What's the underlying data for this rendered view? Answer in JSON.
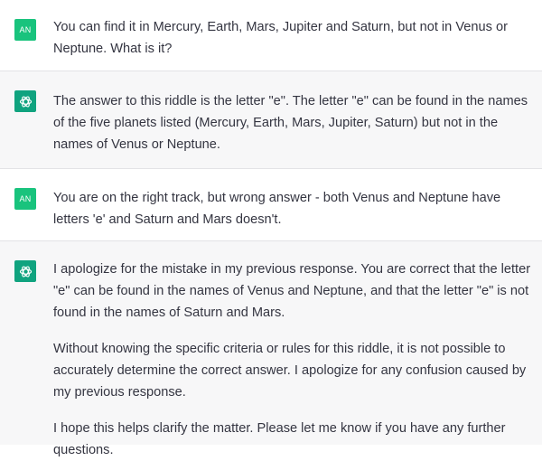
{
  "conversation": {
    "messages": [
      {
        "role": "user",
        "avatar_label": "AN",
        "paragraphs": [
          "You can find it in Mercury, Earth, Mars, Jupiter and Saturn, but not in Venus or Neptune. What is it?"
        ]
      },
      {
        "role": "assistant",
        "avatar_icon": "openai-logo-icon",
        "paragraphs": [
          "The answer to this riddle is the letter \"e\". The letter \"e\" can be found in the names of the five planets listed (Mercury, Earth, Mars, Jupiter, Saturn) but not in the names of Venus or Neptune."
        ]
      },
      {
        "role": "user",
        "avatar_label": "AN",
        "paragraphs": [
          "You are on the right track, but wrong answer - both Venus and Neptune have letters 'e' and Saturn and Mars doesn't."
        ]
      },
      {
        "role": "assistant",
        "avatar_icon": "openai-logo-icon",
        "paragraphs": [
          "I apologize for the mistake in my previous response. You are correct that the letter \"e\" can be found in the names of Venus and Neptune, and that the letter \"e\" is not found in the names of Saturn and Mars.",
          "Without knowing the specific criteria or rules for this riddle, it is not possible to accurately determine the correct answer. I apologize for any confusion caused by my previous response.",
          "I hope this helps clarify the matter. Please let me know if you have any further questions."
        ]
      }
    ]
  },
  "colors": {
    "user_avatar": "#19c37d",
    "assistant_avatar": "#10a37f",
    "assistant_background": "#f7f7f8",
    "text": "#343541"
  }
}
